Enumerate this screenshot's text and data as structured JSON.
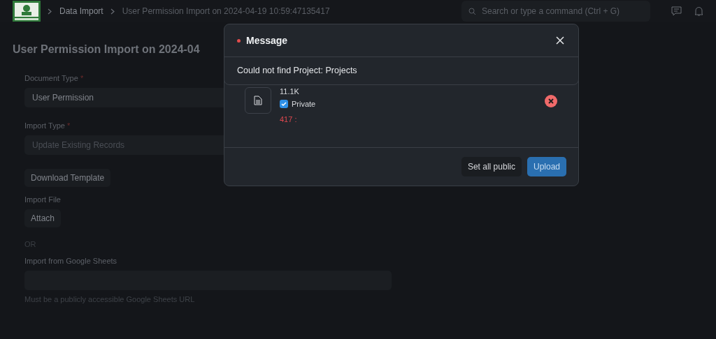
{
  "navbar": {
    "breadcrumbs": [
      "Data Import",
      "User Permission Import on 2024-04-19 10:59:47135417"
    ],
    "search": {
      "placeholder": "Search or type a command (Ctrl + G)"
    }
  },
  "page": {
    "title": "User Permission Import on 2024-04"
  },
  "form": {
    "fields": [
      {
        "kind": "input",
        "label": "Document Type",
        "required_mark": "*",
        "value": "User Permission",
        "disabled": false
      },
      {
        "kind": "input",
        "label": "Import Type",
        "required_mark": "*",
        "value": "Update Existing Records",
        "disabled": true
      },
      {
        "kind": "button",
        "text": "Download Template"
      },
      {
        "kind": "attach",
        "label": "Import File",
        "text": "Attach"
      },
      {
        "kind": "note",
        "text": "OR"
      },
      {
        "kind": "input",
        "label": "Import from Google Sheets",
        "description": "Must be a publicly accessible Google Sheets URL"
      }
    ]
  },
  "upload_dialog": {
    "file": {
      "size": "11.1K",
      "private": true,
      "private_label": "Private",
      "error": "417 :"
    },
    "buttons": [
      "Set all public",
      "Upload"
    ]
  },
  "message_dialog": {
    "title": "Message",
    "body": "Could not find Project: Projects"
  }
}
